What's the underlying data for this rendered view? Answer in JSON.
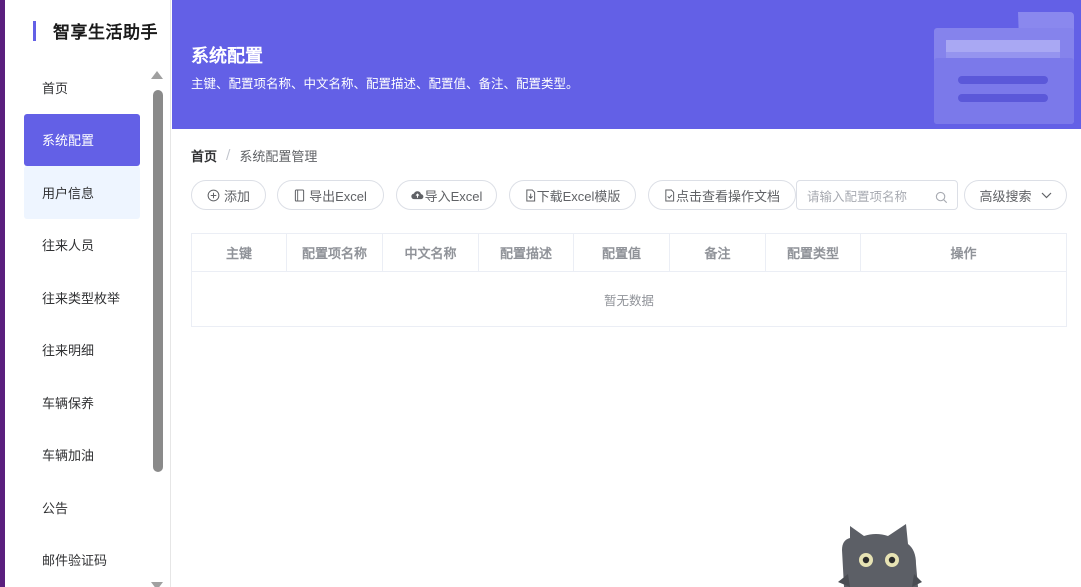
{
  "app": {
    "title": "智享生活助手"
  },
  "sidebar": {
    "items": [
      {
        "label": "首页",
        "state": "normal"
      },
      {
        "label": "系统配置",
        "state": "active"
      },
      {
        "label": "用户信息",
        "state": "hover"
      },
      {
        "label": "往来人员",
        "state": "normal"
      },
      {
        "label": "往来类型枚举",
        "state": "normal"
      },
      {
        "label": "往来明细",
        "state": "normal"
      },
      {
        "label": "车辆保养",
        "state": "normal"
      },
      {
        "label": "车辆加油",
        "state": "normal"
      },
      {
        "label": "公告",
        "state": "normal"
      },
      {
        "label": "邮件验证码",
        "state": "normal"
      }
    ]
  },
  "banner": {
    "title": "系统配置",
    "description": "主键、配置项名称、中文名称、配置描述、配置值、备注、配置类型。"
  },
  "breadcrumb": {
    "home": "首页",
    "separator": "/",
    "current": "系统配置管理"
  },
  "toolbar": {
    "add_label": "添加",
    "export_label": "导出Excel",
    "import_label": "导入Excel",
    "download_template_label": "下载Excel模版",
    "view_docs_label": "点击查看操作文档",
    "search_placeholder": "请输入配置项名称",
    "advanced_search_label": "高级搜索"
  },
  "table": {
    "columns": [
      "主键",
      "配置项名称",
      "中文名称",
      "配置描述",
      "配置值",
      "备注",
      "配置类型",
      "操作"
    ],
    "rows": [],
    "empty_text": "暂无数据"
  },
  "colors": {
    "accent": "#6360e6",
    "banner_bg": "#6360e6",
    "sidebar_hover": "#eef5ff",
    "border": "#dcdfe6",
    "window_edge": "#5a1f7e"
  },
  "icons": {
    "add": "plus-circle-icon",
    "export": "document-icon",
    "import": "cloud-upload-icon",
    "download": "document-download-icon",
    "docs": "document-check-icon",
    "search": "search-icon",
    "advanced": "chevron-down-icon",
    "banner_art": "folder-icon",
    "mascot": "cat-mascot-icon"
  }
}
